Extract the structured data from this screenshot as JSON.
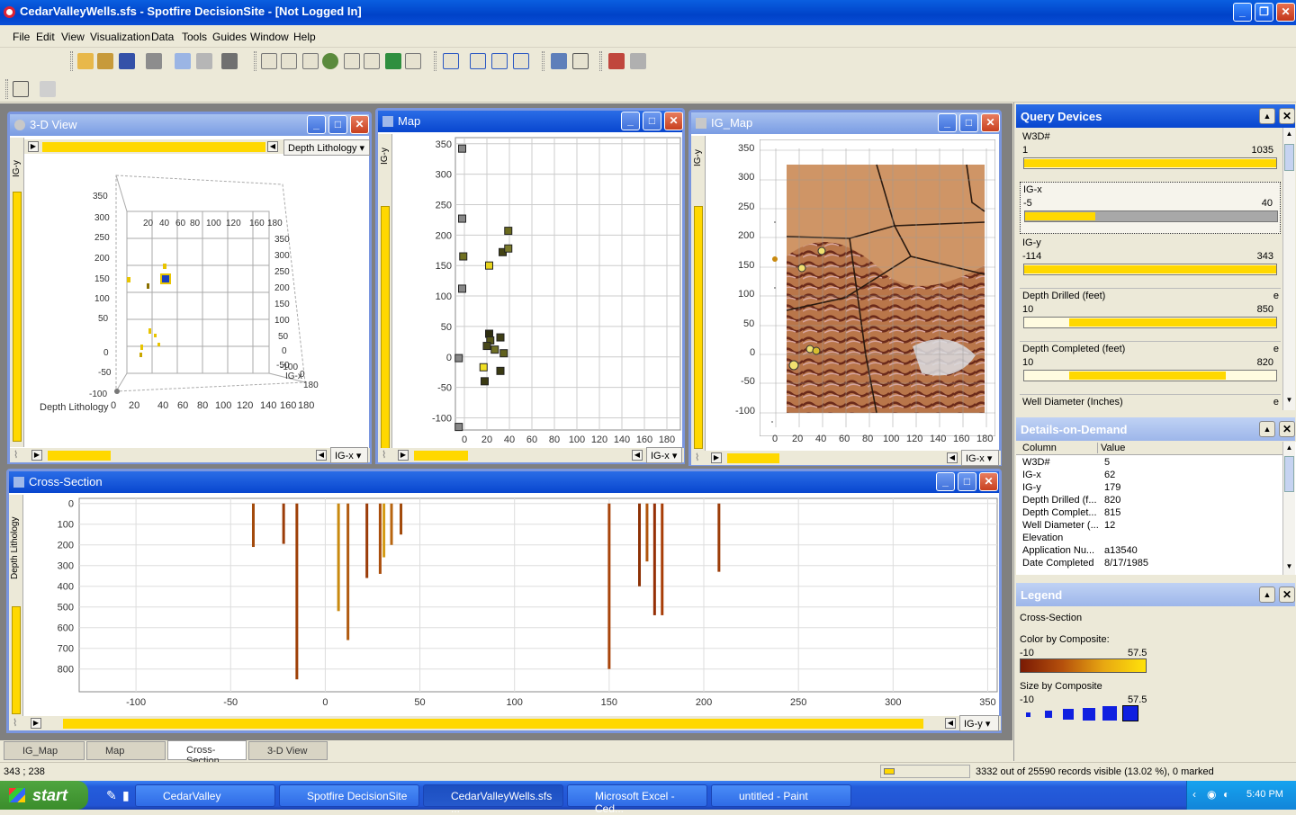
{
  "app": {
    "title": "CedarValleyWells.sfs - Spotfire DecisionSite - [Not Logged In]"
  },
  "menu": [
    "File",
    "Edit",
    "View",
    "Visualization",
    "Data",
    "Tools",
    "Guides",
    "Window",
    "Help"
  ],
  "view3d": {
    "title": "3-D View",
    "combo": "Depth Lithology",
    "x_axis_combo": "IG-x",
    "side_label": "IG-y",
    "axis_label": "Depth Lithology",
    "y_ticks": [
      "350",
      "300",
      "250",
      "200",
      "150",
      "100",
      "50",
      "0",
      "-50",
      "-100"
    ],
    "y_ticks_right": [
      "350",
      "300",
      "250",
      "200",
      "150",
      "100",
      "50",
      "0",
      "-50"
    ],
    "x_ticks_top": [
      "20",
      "40",
      "60",
      "80",
      "100",
      "120",
      "160",
      "180"
    ],
    "x_ticks_bottom": [
      "0",
      "20",
      "40",
      "60",
      "80",
      "100",
      "120",
      "140",
      "160",
      "180"
    ],
    "corner_labels": [
      "-100",
      "0",
      "IG-x",
      "180"
    ]
  },
  "map": {
    "title": "Map",
    "x_axis_combo": "IG-x",
    "side_label": "IG-y",
    "chart_data": {
      "type": "scatter",
      "x_ticks": [
        0,
        20,
        40,
        60,
        80,
        100,
        120,
        140,
        160,
        180
      ],
      "y_ticks": [
        350,
        300,
        250,
        200,
        150,
        100,
        50,
        0,
        -50,
        -100
      ],
      "xlim": [
        -8,
        192
      ],
      "ylim": [
        -120,
        360
      ],
      "points": [
        {
          "x": -2,
          "y": 342,
          "c": "#888888"
        },
        {
          "x": -2,
          "y": 227,
          "c": "#888888"
        },
        {
          "x": -2,
          "y": 112,
          "c": "#888888"
        },
        {
          "x": -5,
          "y": -2,
          "c": "#888888"
        },
        {
          "x": -5,
          "y": -115,
          "c": "#888888"
        },
        {
          "x": -1,
          "y": 165,
          "c": "#707020"
        },
        {
          "x": 22,
          "y": 150,
          "c": "#e6d21c"
        },
        {
          "x": 39,
          "y": 207,
          "c": "#6a6a1e"
        },
        {
          "x": 34,
          "y": 172,
          "c": "#434314"
        },
        {
          "x": 39,
          "y": 178,
          "c": "#7a7a2a"
        },
        {
          "x": 22,
          "y": 38,
          "c": "#2e2e10"
        },
        {
          "x": 23,
          "y": 27,
          "c": "#555518"
        },
        {
          "x": 32,
          "y": 32,
          "c": "#3e3e15"
        },
        {
          "x": 27,
          "y": 12,
          "c": "#707024"
        },
        {
          "x": 35,
          "y": 6,
          "c": "#60601c"
        },
        {
          "x": 20,
          "y": 18,
          "c": "#48481a"
        },
        {
          "x": 17,
          "y": -17,
          "c": "#f0df24"
        },
        {
          "x": 18,
          "y": -40,
          "c": "#3a3a12"
        },
        {
          "x": 32,
          "y": -23,
          "c": "#3a3a12"
        }
      ]
    }
  },
  "igmap": {
    "title": "IG_Map",
    "x_axis_combo": "IG-x",
    "side_label": "IG-y",
    "x_ticks": [
      "0",
      "20",
      "40",
      "60",
      "80",
      "100",
      "120",
      "140",
      "160",
      "180"
    ],
    "y_ticks": [
      "350",
      "300",
      "250",
      "200",
      "150",
      "100",
      "50",
      "0",
      "-50",
      "-100"
    ]
  },
  "cross": {
    "title": "Cross-Section",
    "side_label": "Depth Lithology",
    "x_axis_combo": "IG-y",
    "chart_data": {
      "type": "bar",
      "x_ticks": [
        -100,
        -50,
        0,
        50,
        100,
        150,
        200,
        250,
        300,
        350
      ],
      "y_ticks": [
        0,
        100,
        200,
        300,
        400,
        500,
        600,
        700,
        800
      ],
      "xlim": [
        -130,
        355
      ],
      "ylim": [
        -25,
        910
      ],
      "wells": [
        {
          "x": -38,
          "top": 0,
          "bottom": 210,
          "c": "#a34a0c"
        },
        {
          "x": -22,
          "top": 0,
          "bottom": 195,
          "c": "#9b3c08"
        },
        {
          "x": -15,
          "top": 0,
          "bottom": 850,
          "c": "#9e3f06"
        },
        {
          "x": 7,
          "top": 0,
          "bottom": 520,
          "c": "#c98a10"
        },
        {
          "x": 12,
          "top": 0,
          "bottom": 660,
          "c": "#b05a10"
        },
        {
          "x": 22,
          "top": 0,
          "bottom": 360,
          "c": "#9b3c08"
        },
        {
          "x": 29,
          "top": 0,
          "bottom": 340,
          "c": "#aa4e0c"
        },
        {
          "x": 31,
          "top": 0,
          "bottom": 260,
          "c": "#d49b14"
        },
        {
          "x": 40,
          "top": 0,
          "bottom": 150,
          "c": "#a24a0b"
        },
        {
          "x": 35,
          "top": 0,
          "bottom": 200,
          "c": "#b8650f"
        },
        {
          "x": 150,
          "top": 0,
          "bottom": 800,
          "c": "#a8450b"
        },
        {
          "x": 166,
          "top": 0,
          "bottom": 400,
          "c": "#8d3105"
        },
        {
          "x": 170,
          "top": 0,
          "bottom": 280,
          "c": "#b0550d"
        },
        {
          "x": 174,
          "top": 0,
          "bottom": 540,
          "c": "#952f06"
        },
        {
          "x": 178,
          "top": 0,
          "bottom": 540,
          "c": "#a83d07"
        },
        {
          "x": 208,
          "top": 0,
          "bottom": 330,
          "c": "#9b3c08"
        }
      ]
    }
  },
  "query": {
    "title": "Query Devices",
    "items": [
      {
        "name": "W3D#",
        "min": "1",
        "max": "1035",
        "fill_from": 0,
        "fill_to": 1.0,
        "flag": ""
      },
      {
        "name": "IG-x",
        "min": "-5",
        "max": "40",
        "fill_from": 0,
        "fill_to": 0.28,
        "flag": ""
      },
      {
        "name": "IG-y",
        "min": "-114",
        "max": "343",
        "fill_from": 0,
        "fill_to": 1.0,
        "flag": ""
      },
      {
        "name": "Depth Drilled (feet)",
        "min": "10",
        "max": "850",
        "fill_from": 0.18,
        "fill_to": 1.0,
        "flag": "e"
      },
      {
        "name": "Depth Completed (feet)",
        "min": "10",
        "max": "820",
        "fill_from": 0.18,
        "fill_to": 0.8,
        "flag": "e"
      },
      {
        "name": "Well Diameter (Inches)",
        "min": "",
        "max": "",
        "fill_from": 0,
        "fill_to": 0,
        "flag": "e"
      }
    ]
  },
  "dod": {
    "title": "Details-on-Demand",
    "col_header": "Column",
    "val_header": "Value",
    "rows": [
      [
        "W3D#",
        "5"
      ],
      [
        "IG-x",
        "62"
      ],
      [
        "IG-y",
        "179"
      ],
      [
        "Depth Drilled (f...",
        "820"
      ],
      [
        "Depth Complet...",
        "815"
      ],
      [
        "Well Diameter (...",
        "12"
      ],
      [
        "Elevation",
        ""
      ],
      [
        "Application Nu...",
        "a13540"
      ],
      [
        "Date Completed",
        "8/17/1985"
      ]
    ]
  },
  "legend": {
    "title": "Legend",
    "subject": "Cross-Section",
    "color_label": "Color by Composite:",
    "color_min": "-10",
    "color_max": "57.5",
    "size_label": "Size by Composite",
    "size_min": "-10",
    "size_max": "57.5"
  },
  "tabs": [
    "IG_Map",
    "Map",
    "Cross-Section",
    "3-D View"
  ],
  "status": {
    "coords": "343 ; 238",
    "records": "3332 out of 25590 records visible (13.02 %), 0 marked"
  },
  "taskbar": {
    "start": "start",
    "tasks": [
      "CedarValley",
      "Spotfire DecisionSite",
      "CedarValleyWells.sfs ...",
      "Microsoft Excel - Ced...",
      "untitled - Paint"
    ],
    "time": "5:40 PM"
  },
  "colors": {
    "accent": "#ffd800",
    "title_active": "#0846cf"
  }
}
